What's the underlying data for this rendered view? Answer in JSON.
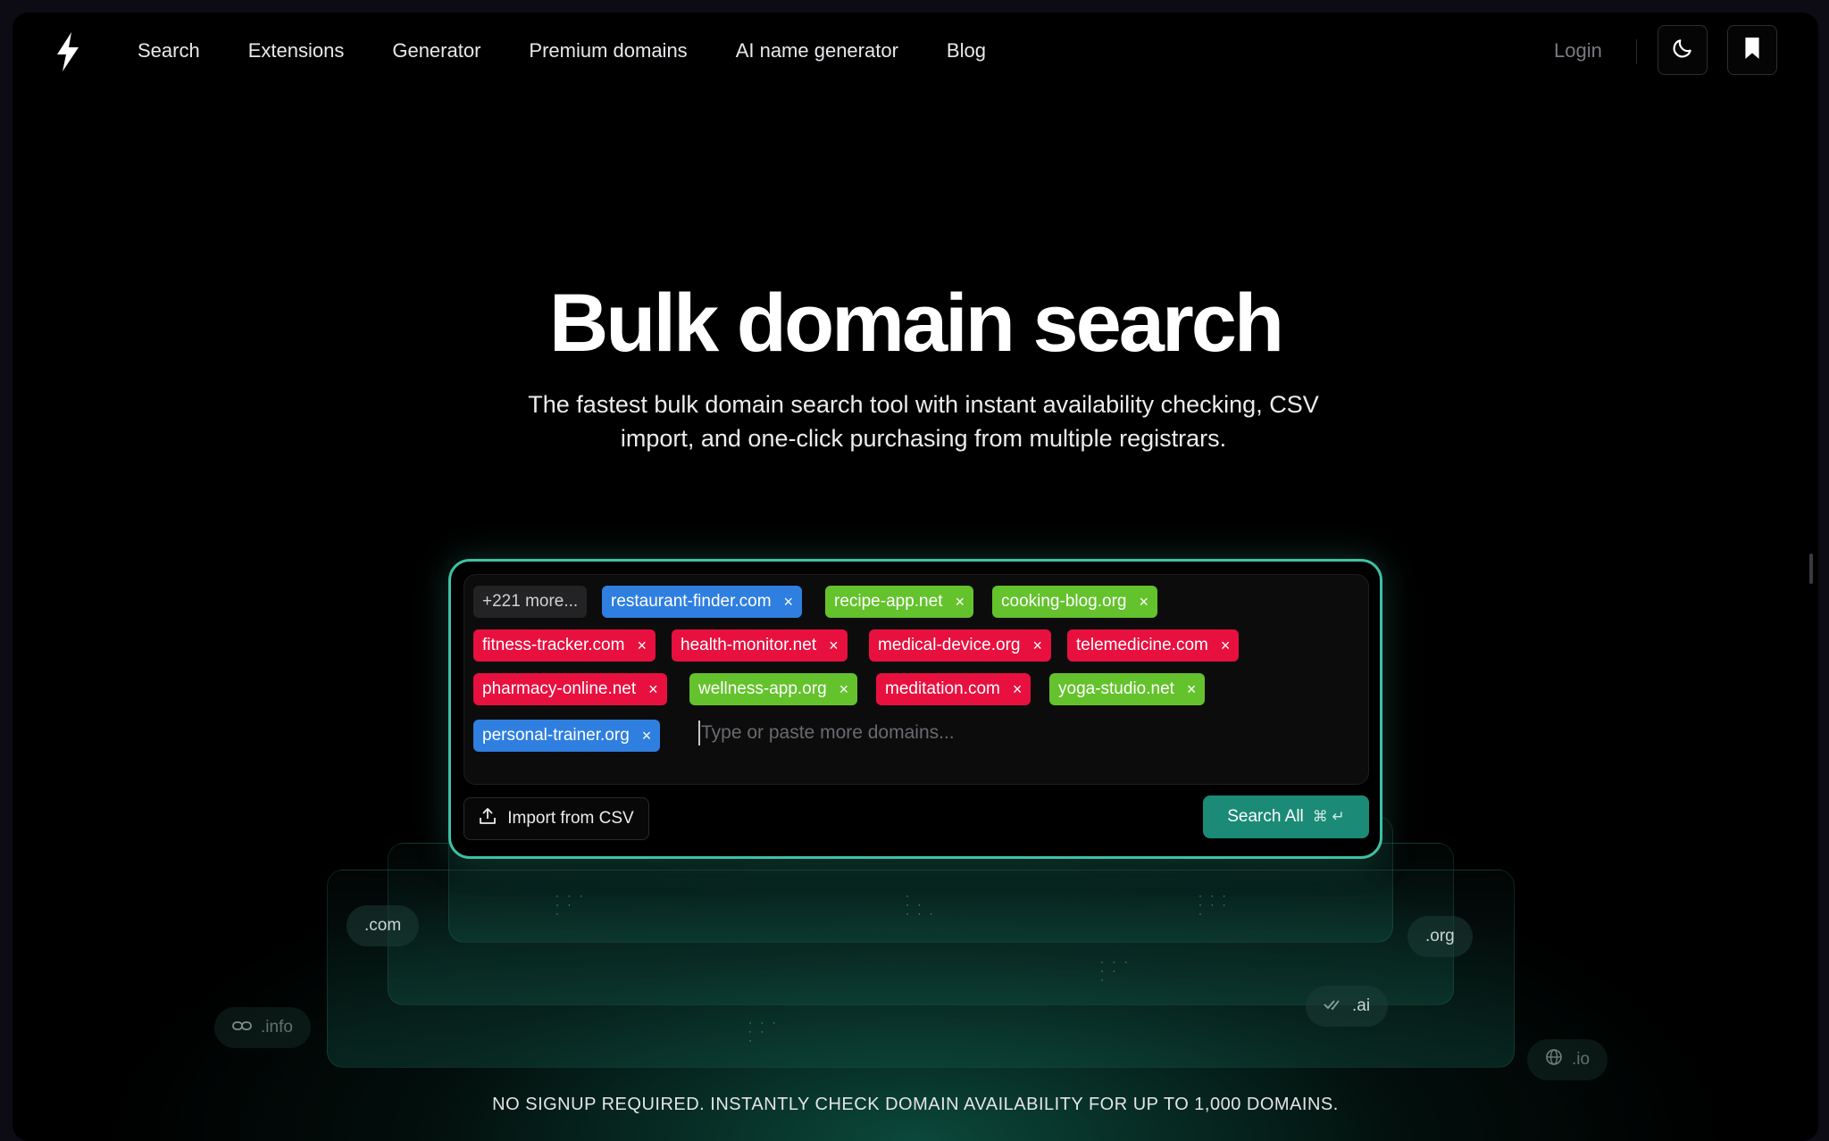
{
  "nav": {
    "links": [
      "Search",
      "Extensions",
      "Generator",
      "Premium domains",
      "AI name generator",
      "Blog"
    ],
    "login": "Login"
  },
  "hero": {
    "title": "Bulk domain search",
    "subtitle": "The fastest bulk domain search tool with instant availability checking, CSV import, and one-click purchasing from multiple registrars."
  },
  "search": {
    "more_label": "+221 more...",
    "domains": [
      {
        "name": "restaurant-finder.com",
        "status": "blue"
      },
      {
        "name": "recipe-app.net",
        "status": "green"
      },
      {
        "name": "cooking-blog.org",
        "status": "green"
      },
      {
        "name": "fitness-tracker.com",
        "status": "red"
      },
      {
        "name": "health-monitor.net",
        "status": "red"
      },
      {
        "name": "medical-device.org",
        "status": "red"
      },
      {
        "name": "telemedicine.com",
        "status": "red"
      },
      {
        "name": "pharmacy-online.net",
        "status": "red"
      },
      {
        "name": "wellness-app.org",
        "status": "green"
      },
      {
        "name": "meditation.com",
        "status": "red"
      },
      {
        "name": "yoga-studio.net",
        "status": "green"
      },
      {
        "name": "personal-trainer.org",
        "status": "blue"
      }
    ],
    "remove_glyph": "×",
    "placeholder": "Type or paste more domains...",
    "import_label": "Import from CSV",
    "search_label": "Search All",
    "shortcut": "⌘ ↵"
  },
  "tlds": {
    "com": ".com",
    "org": ".org",
    "ai": ".ai",
    "info": ".info",
    "io": ".io"
  },
  "footnote": "NO SIGNUP REQUIRED. INSTANTLY CHECK DOMAIN AVAILABILITY FOR UP TO 1,000 DOMAINS.",
  "colors": {
    "accent": "#3fc0a4",
    "search_button": "#1b8a77",
    "chip_blue": "#2f7fe0",
    "chip_green": "#64c22c",
    "chip_red": "#e8103f"
  },
  "icons": {
    "logo": "lightning-bolt-icon",
    "theme": "moon-icon",
    "saved": "bookmark-icon",
    "import": "upload-icon",
    "info_chip": "link-icon",
    "ai_chip": "double-check-icon",
    "io_chip": "globe-icon"
  }
}
